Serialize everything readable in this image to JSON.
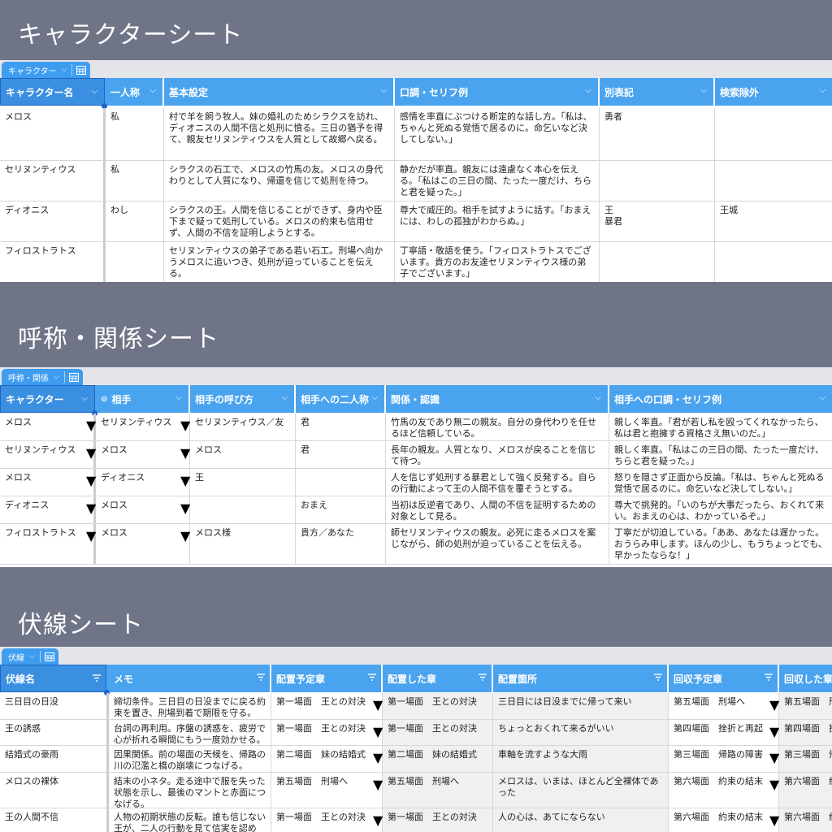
{
  "sections": {
    "character_title": "キャラクターシート",
    "relation_title": "呼称・関係シート",
    "foreshadow_title": "伏線シート"
  },
  "character": {
    "tab_label": "キャラクター",
    "headers": [
      "キャラクター名",
      "一人称",
      "基本設定",
      "口調・セリフ例",
      "別表記",
      "検索除外"
    ],
    "rows": [
      [
        "メロス",
        "私",
        "村で羊を飼う牧人。妹の婚礼のためシラクスを訪れ、ディオニスの人間不信と処刑に憤る。三日の猶予を得て、親友セリヌンティウスを人質として故郷へ戻る。",
        "感情を率直にぶつける断定的な話し方。「私は、ちゃんと死ぬる覚悟で居るのに。命乞いなど決してしない。」",
        "勇者",
        ""
      ],
      [
        "セリヌンティウス",
        "私",
        "シラクスの石工で、メロスの竹馬の友。メロスの身代わりとして人質になり、帰還を信じて処刑を待つ。",
        "静かだが率直。親友には遠慮なく本心を伝える。「私はこの三日の間、たった一度だけ、ちらと君を疑った。」",
        "",
        ""
      ],
      [
        "ディオニス",
        "わし",
        "シラクスの王。人間を信じることができず、身内や臣下まで疑って処刑している。メロスの約束も信用せず、人間の不信を証明しようとする。",
        "尊大で威圧的。相手を試すように話す。「おまえには、わしの孤独がわからぬ。」",
        "王\n暴君",
        "王城"
      ],
      [
        "フィロストラトス",
        "",
        "セリヌンティウスの弟子である若い石工。刑場へ向かうメロスに追いつき、処刑が迫っていることを伝える。",
        "丁寧語・敬語を使う。「フィロストラトスでございます。貴方のお友達セリヌンティウス様の弟子でございます。」",
        "",
        ""
      ]
    ]
  },
  "relation": {
    "tab_label": "呼称・関係",
    "headers": [
      "キャラクター",
      "相手",
      "相手の呼び方",
      "相手への二人称",
      "関係・認識",
      "相手への口調・セリフ例"
    ],
    "rows": [
      [
        "メロス",
        "セリヌンティウス",
        "セリヌンティウス／友",
        "君",
        "竹馬の友であり無二の親友。自分の身代わりを任せるほど信頼している。",
        "親しく率直。「君が若し私を殴ってくれなかったら、私は君と抱擁する資格さえ無いのだ。」"
      ],
      [
        "セリヌンティウス",
        "メロス",
        "メロス",
        "君",
        "長年の親友。人質となり、メロスが戻ることを信じて待つ。",
        "親しく率直。「私はこの三日の間、たった一度だけ、ちらと君を疑った。」"
      ],
      [
        "メロス",
        "ディオニス",
        "王",
        "",
        "人を信じず処刑する暴君として強く反発する。自らの行動によって王の人間不信を覆そうとする。",
        "怒りを隠さず正面から反論。「私は、ちゃんと死ぬる覚悟で居るのに。命乞いなど決してしない。」"
      ],
      [
        "ディオニス",
        "メロス",
        "",
        "おまえ",
        "当初は反逆者であり、人間の不信を証明するための対象として見る。",
        "尊大で挑発的。「いのちが大事だったら、おくれて来い。おまえの心は、わかっているぞ。」"
      ],
      [
        "フィロストラトス",
        "メロス",
        "メロス様",
        "貴方／あなた",
        "師セリヌンティウスの親友。必死に走るメロスを案じながら、師の処刑が迫っていることを伝える。",
        "丁寧だが切迫している。「ああ、あなたは遅かった。おうらみ申します。ほんの少し、もうちょっとでも、早かったならな！」"
      ]
    ]
  },
  "foreshadow": {
    "tab_label": "伏線",
    "headers": [
      "伏線名",
      "メモ",
      "配置予定章",
      "配置した章",
      "配置箇所",
      "回収予定章",
      "回収した章"
    ],
    "rows": [
      [
        "三日目の日没",
        "締切条件。三日目の日没までに戻る約束を置き、刑場到着で期限を守る。",
        "第一場面　王との対決",
        "第一場面　王との対決",
        "三日目には日没までに帰って来い",
        "第五場面　刑場へ",
        "第五場面　刑場へ"
      ],
      [
        "王の誘惑",
        "台詞の再利用。序盤の誘惑を、疲労で心が折れる瞬間にもう一度効かせる。",
        "第一場面　王との対決",
        "第一場面　王との対決",
        "ちょっとおくれて来るがいい",
        "第四場面　挫折と再起",
        "第四場面　挫折と再起"
      ],
      [
        "結婚式の豪雨",
        "因果関係。前の場面の天候を、帰路の川の氾濫と橋の崩壊につなげる。",
        "第二場面　妹の結婚式",
        "第二場面　妹の結婚式",
        "車軸を流すような大雨",
        "第三場面　帰路の障害",
        "第三場面　帰路の障害"
      ],
      [
        "メロスの裸体",
        "結末の小ネタ。走る途中で服を失った状態を示し、最後のマントと赤面につなげる。",
        "第五場面　刑場へ",
        "第五場面　刑場へ",
        "メロスは、いまは、ほとんど全裸体であった",
        "第六場面　約束の結末",
        "第六場面　約束の結末"
      ],
      [
        "王の人間不信",
        "人物の初期状態の反転。誰も信じない王が、二人の行動を見て信実を認める。",
        "第一場面　王との対決",
        "第一場面　王との対決",
        "人の心は、あてにならない",
        "第六場面　約束の結末",
        "第六場面　約束の結末"
      ]
    ]
  },
  "icons": {
    "tab_grid": "table-grid-icon",
    "dropdown": "chevron-down-icon",
    "filter": "filter-icon",
    "link": "link-icon"
  },
  "colors": {
    "background": "#6f7586",
    "header": "#4aa3ee",
    "selection": "#1e64c8"
  }
}
